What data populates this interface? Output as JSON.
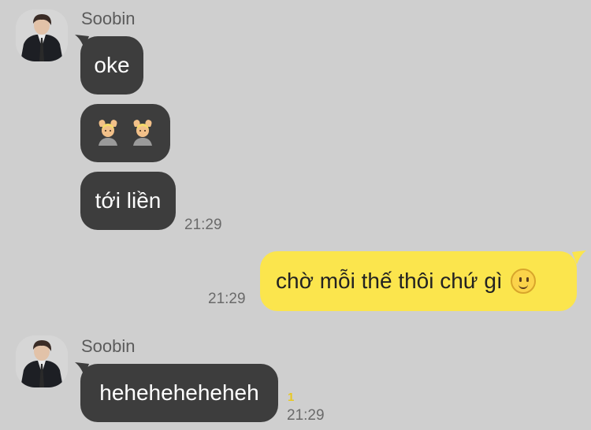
{
  "messages": {
    "group1": {
      "sender": "Soobin",
      "bubble1": "oke",
      "bubble2_emoji_name": "person-gesturing-ok-emoji x2",
      "bubble3": "tới liền",
      "time": "21:29"
    },
    "mine": {
      "text": "chờ mỗi thế thôi chứ gì",
      "emoji_name": "slightly-smiling-face-emoji",
      "time": "21:29"
    },
    "group2": {
      "sender": "Soobin",
      "bubble1": "heheheheheheh",
      "unread": "1",
      "time": "21:29"
    }
  },
  "colors": {
    "background": "#cfcfcf",
    "incoming_bubble": "#3d3d3d",
    "outgoing_bubble": "#fbe54d",
    "unread_count": "#e8c81f"
  }
}
